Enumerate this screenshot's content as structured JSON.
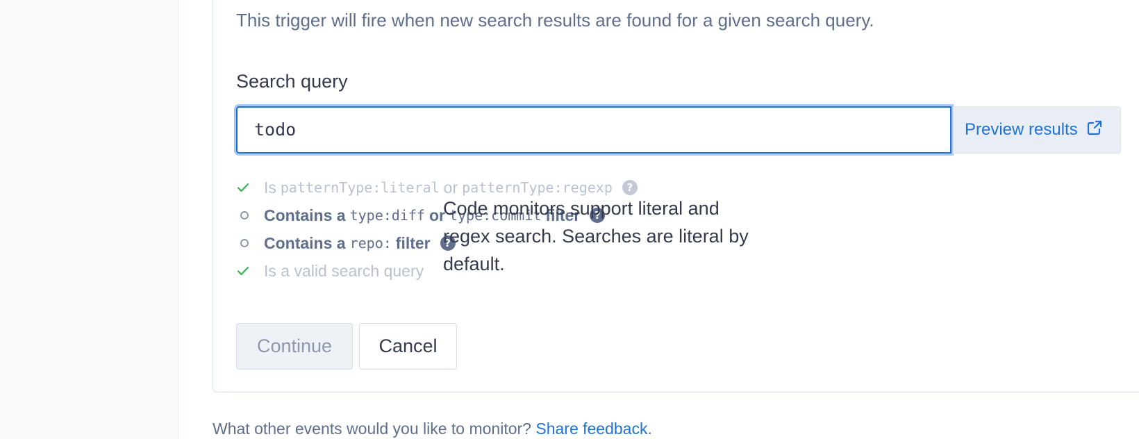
{
  "trigger": {
    "description": "This trigger will fire when new search results are found for a given search query.",
    "query_label": "Search query",
    "query_value": "todo",
    "preview_label": "Preview results"
  },
  "checks": [
    {
      "status": "done",
      "pre": "Is ",
      "code1": "patternType:literal",
      "mid": " or ",
      "code2": "patternType:regexp",
      "post": "",
      "help": true
    },
    {
      "status": "todo",
      "pre": "Contains a ",
      "code1": "type:diff",
      "mid": " or ",
      "code2": "type:commit",
      "post": " filter",
      "help": true
    },
    {
      "status": "todo",
      "pre": "Contains a ",
      "code1": "repo:",
      "mid": "",
      "code2": "",
      "post": " filter",
      "help": true
    },
    {
      "status": "done",
      "pre": "Is a valid search query",
      "code1": "",
      "mid": "",
      "code2": "",
      "post": "",
      "help": false
    }
  ],
  "tooltip": "Code monitors support literal and regex search. Searches are literal by default.",
  "buttons": {
    "continue": "Continue",
    "cancel": "Cancel"
  },
  "footer": {
    "text": "What other events would you like to monitor? ",
    "link": "Share feedback",
    "end": "."
  },
  "colors": {
    "accent": "#1f72d6",
    "check_done": "#37b24d"
  }
}
